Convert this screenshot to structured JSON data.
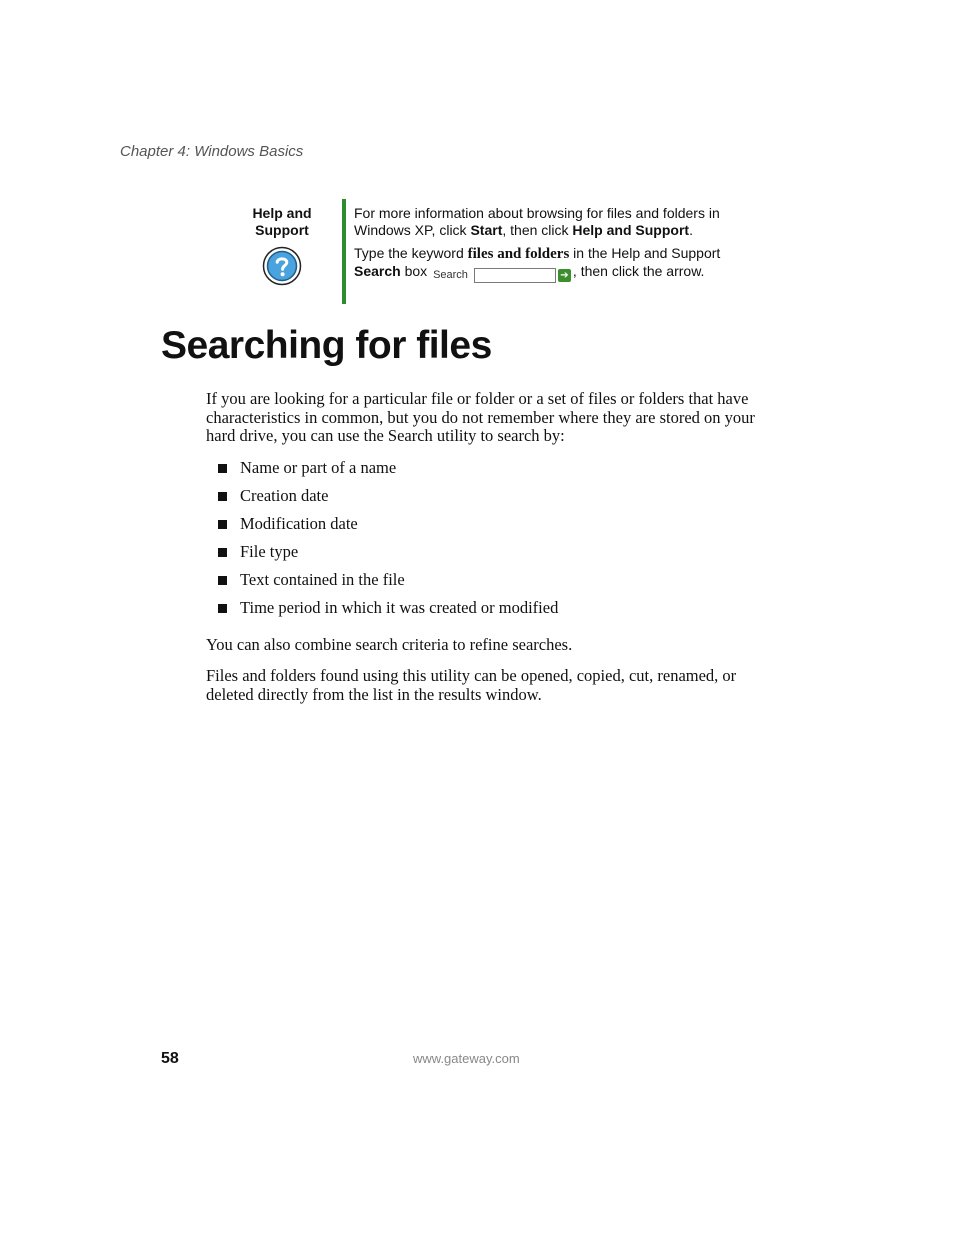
{
  "header": {
    "chapter": "Chapter 4: Windows Basics"
  },
  "sidebar": {
    "label_line1": "Help and",
    "label_line2": "Support",
    "icon": "help-question-icon",
    "accent_color": "#2e8b2e",
    "p1_before": "For more information about browsing for files and folders in Windows XP, click ",
    "p1_start": "Start",
    "p1_mid": ", then click ",
    "p1_help": "Help and Support",
    "p1_end": ".",
    "p2_before": "Type the keyword ",
    "p2_keyword": "files and folders",
    "p2_mid": " in the Help and Support ",
    "p2_search": "Search",
    "p2_box": " box ",
    "search_label": "Search",
    "p2_end": ", then click the arrow."
  },
  "section": {
    "title": "Searching for files"
  },
  "body": {
    "intro": "If you are looking for a particular file or folder or a set of files or folders that have characteristics in common, but you do not remember where they are stored on your hard drive, you can use the Search utility to search by:",
    "criteria": [
      "Name or part of a name",
      "Creation date",
      "Modification date",
      "File type",
      "Text contained in the file",
      "Time period in which it was created or modified"
    ],
    "combine": "You can also combine search criteria to refine searches.",
    "results": "Files and folders found using this utility can be opened, copied, cut, renamed, or deleted directly from the list in the results window."
  },
  "footer": {
    "page_number": "58",
    "url": "www.gateway.com"
  }
}
